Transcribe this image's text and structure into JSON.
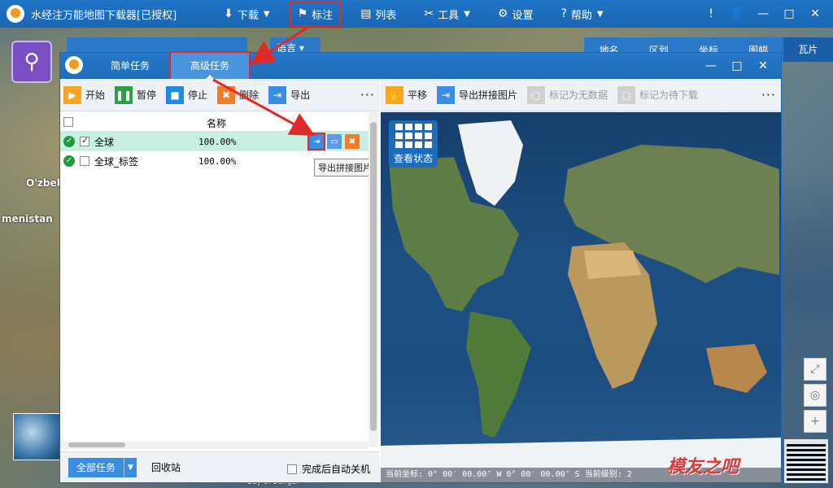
{
  "app": {
    "title": "水经注万能地图下载器[已授权]"
  },
  "topmenu": [
    {
      "label": "下载",
      "icon": "⬇",
      "caret": true
    },
    {
      "label": "标注",
      "icon": "⚑",
      "caret": false,
      "highlighted": true
    },
    {
      "label": "列表",
      "icon": "▤",
      "caret": false
    },
    {
      "label": "工具",
      "icon": "✂",
      "caret": true
    },
    {
      "label": "设置",
      "icon": "⚙",
      "caret": false
    },
    {
      "label": "帮助",
      "icon": "?",
      "caret": true
    }
  ],
  "window_controls": {
    "info": "!",
    "user": "👤",
    "minimize": "—",
    "maximize": "□",
    "close": "✕"
  },
  "background": {
    "lang_label": "语言 ▾",
    "map_tabs": [
      "地名",
      "区划",
      "坐标",
      "图幅",
      "瓦片"
    ],
    "labels": [
      "O'zbek",
      "menistan",
      "Bay of Bengal"
    ]
  },
  "taskwin": {
    "tabs": [
      "简单任务",
      "高级任务"
    ],
    "active_tab": "高级任务",
    "controls": {
      "minimize": "—",
      "maximize": "□",
      "close": "✕"
    },
    "toolbar": [
      {
        "label": "开始",
        "color": "#f5a623",
        "icon": "▶"
      },
      {
        "label": "暂停",
        "color": "#2ea043",
        "icon": "❚❚"
      },
      {
        "label": "停止",
        "color": "#1f8ae0",
        "icon": "■"
      },
      {
        "label": "删除",
        "color": "#f07d2a",
        "icon": "🗑"
      },
      {
        "label": "导出",
        "color": "#3a8de0",
        "icon": "⇥"
      }
    ],
    "more": "···",
    "list_header": {
      "name": "名称"
    },
    "rows": [
      {
        "name": "全球",
        "progress": "100.00%",
        "checked": true,
        "selected": true
      },
      {
        "name": "全球_标签",
        "progress": "100.00%",
        "checked": false,
        "selected": false
      }
    ],
    "tooltip": "导出拼接图片",
    "bottom": {
      "all_tasks": "全部任务",
      "recycle": "回收站",
      "auto_shutdown": "完成后自动关机"
    }
  },
  "map_toolbar": [
    {
      "label": "平移",
      "color": "#f5a623",
      "icon": "✋",
      "disabled": false
    },
    {
      "label": "导出拼接图片",
      "color": "#3a8de0",
      "icon": "⇥",
      "disabled": false
    },
    {
      "label": "标记为无数据",
      "color": "#c8c8c8",
      "icon": "▢",
      "disabled": true
    },
    {
      "label": "标记为待下载",
      "color": "#c8c8c8",
      "icon": "▢",
      "disabled": true
    }
  ],
  "map": {
    "status_button": "查看状态",
    "coord_text": "当前坐标:  0° 00′ 00.00″ W 0° 00′ 00.00″ S  当前级别: 2"
  },
  "watermark": "模友之吧"
}
